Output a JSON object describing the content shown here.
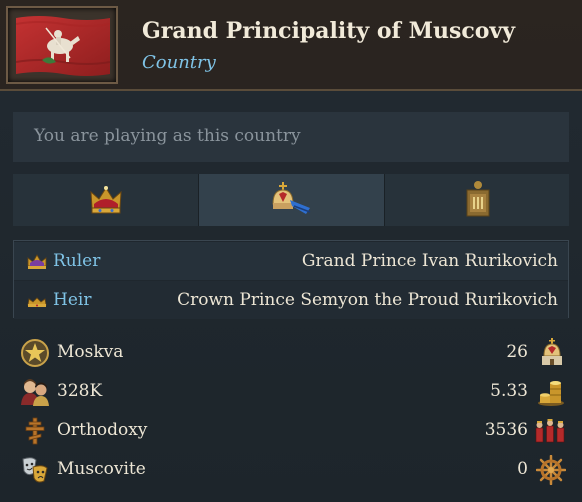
{
  "header": {
    "title": "Grand Principality of Muscovy",
    "subtitle": "Country",
    "flag_icon": "muscovy-flag-icon"
  },
  "playing": {
    "text": "You are playing as this country"
  },
  "tabs": [
    {
      "icon": "crown-icon",
      "active": false
    },
    {
      "icon": "church-dome-icon",
      "active": true
    },
    {
      "icon": "shield-banner-icon",
      "active": false
    }
  ],
  "leaders": {
    "ruler": {
      "label": "Ruler",
      "value": "Grand Prince Ivan Rurikovich",
      "icon": "small-crown-icon"
    },
    "heir": {
      "label": "Heir",
      "value": "Crown Prince Semyon the Proud Rurikovich",
      "icon": "small-coronet-icon"
    }
  },
  "stats": [
    {
      "label": "Moskva",
      "value": "26",
      "left_icon": "capital-star-icon",
      "right_icon": "church-icon"
    },
    {
      "label": "328K",
      "value": "5.33",
      "left_icon": "population-icon",
      "right_icon": "gold-coins-icon"
    },
    {
      "label": "Orthodoxy",
      "value": "3536",
      "left_icon": "orthodox-cross-icon",
      "right_icon": "army-icon"
    },
    {
      "label": "Muscovite",
      "value": "0",
      "left_icon": "culture-masks-icon",
      "right_icon": "ship-wheel-icon"
    }
  ],
  "colors": {
    "accent_blue": "#7fc3e6",
    "flag_red": "#b52a2a",
    "text_main": "#ede6d5"
  }
}
